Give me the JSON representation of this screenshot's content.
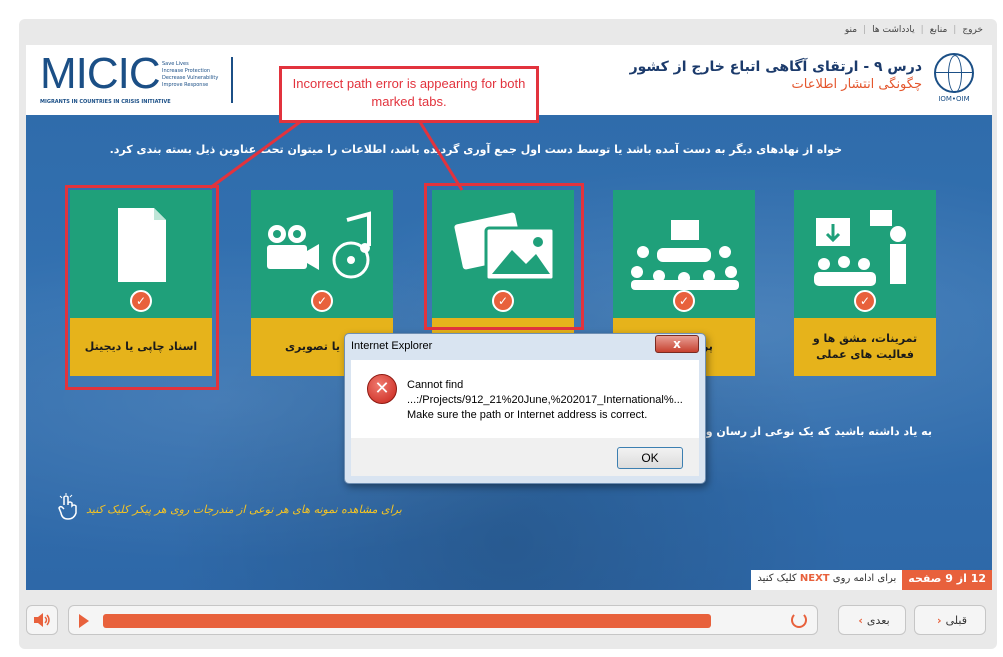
{
  "top_menu": {
    "exit": "خروج",
    "resources": "منابع",
    "notes": "یادداشت ها",
    "menu": "منو"
  },
  "header": {
    "micic_logo": "MICIC",
    "micic_tagline": [
      "Save Lives",
      "Increase Protection",
      "Decrease Vulnerability",
      "Improve Response"
    ],
    "micic_subtitle": "MIGRANTS IN COUNTRIES IN CRISIS INITIATIVE",
    "course_title": "درس ۹ - ارتقای آگاهی اتباع خارج از کشور",
    "course_subtitle": "چگونگی انتشار اطلاعات",
    "iom_label": "IOM•OIM"
  },
  "stage": {
    "intro": "خواه از نهادهای دیگر به دست آمده باشد یا توسط دست اول جمع آوری گردیده باشد، اطلاعات را میتوان تحت عناوین ذیل بسته بندی کرد.",
    "tiles": [
      {
        "label": "اسناد چاپی یا دیجیتل",
        "icon": "document-icon"
      },
      {
        "label": "تی یا تصویری",
        "icon": "video-audio-icon"
      },
      {
        "label": "",
        "icon": "images-icon"
      },
      {
        "label": "پریزنت هم",
        "icon": "presentation-icon"
      },
      {
        "label": "تمرینات، مشق ها و فعالیت های عملی",
        "icon": "training-icon"
      }
    ],
    "note": "به یاد داشته باشید که یک نوعی از رسان وه های متفاوت اتباع به تکنالوژی، سازگار نمائید.",
    "hint": "برای مشاهده نمونه های هر نوعی از مندرجات روی هر پیکر کلیک کنید",
    "callout": "Incorrect path error is appearing for both marked tabs.",
    "page_indicator": "12 از 9 صفحه",
    "continue_text": "برای ادامه روی",
    "continue_next": "NEXT",
    "continue_click": "کلیک کنید"
  },
  "dialog": {
    "title": "Internet Explorer",
    "close": "x",
    "line1": "Cannot find",
    "line2": "...:/Projects/912_21%20June,%202017_International%...",
    "line3": "Make sure the path or Internet address is correct.",
    "ok": "OK"
  },
  "controls": {
    "prev_label": "قبلی",
    "next_label": "بعدی",
    "progress_fraction": 0.9
  },
  "colors": {
    "accent": "#e8613c",
    "tile_green": "#1fa07a",
    "tile_yellow": "#e6b31b",
    "stage_blue": "#3371b1",
    "annotation_red": "#e2333d"
  }
}
